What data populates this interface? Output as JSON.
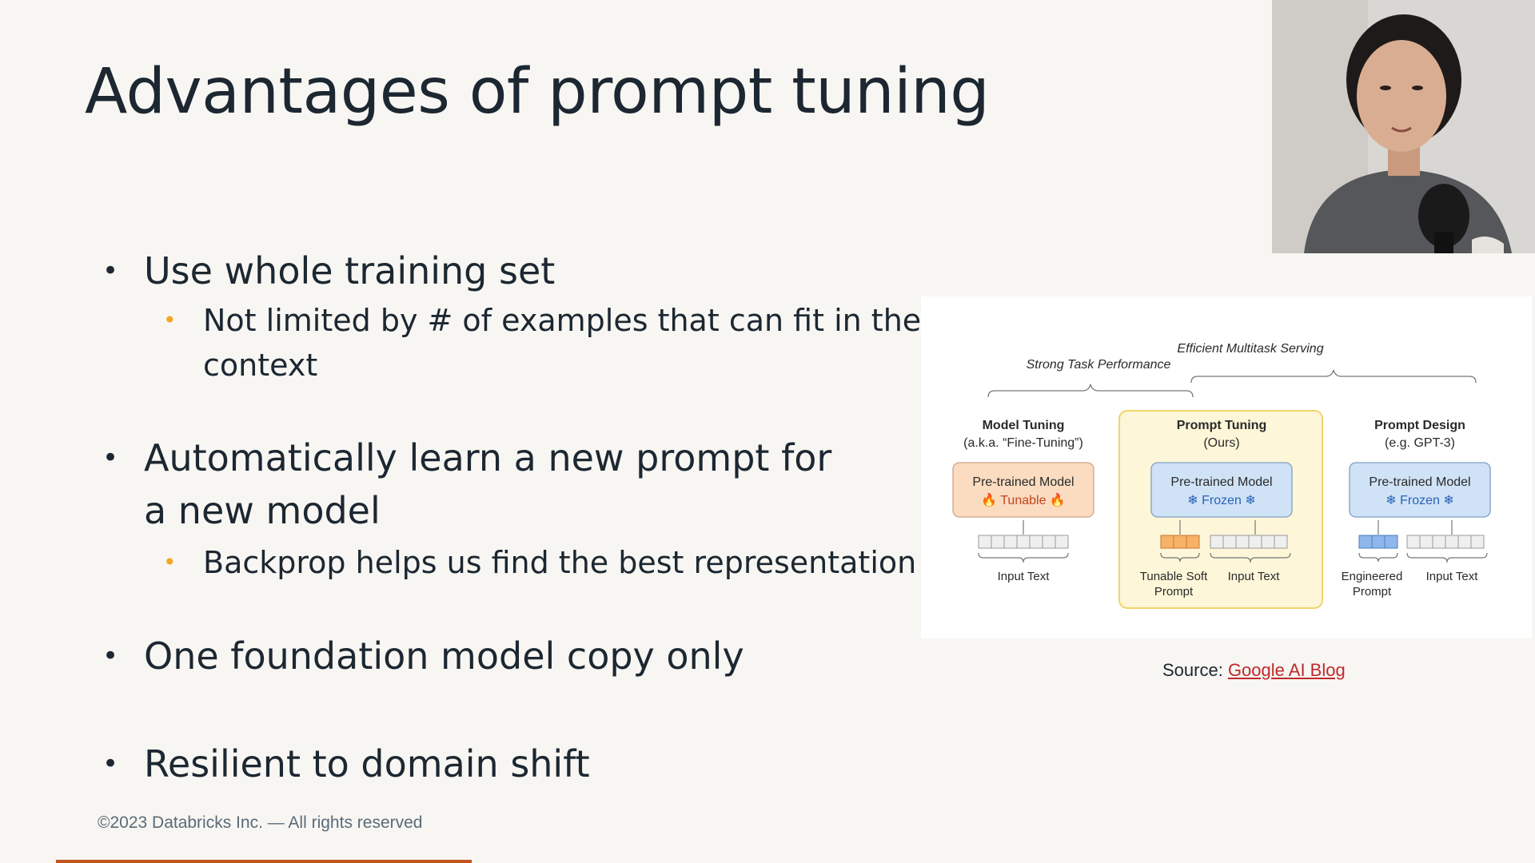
{
  "slide": {
    "title": "Advantages of prompt tuning",
    "bullets": [
      {
        "text": "Use whole training set",
        "sub": [
          "Not limited by # of examples that can fit in the context"
        ]
      },
      {
        "text": "Automatically learn a new prompt for a new model",
        "sub": [
          "Backprop helps us find the best representation"
        ]
      },
      {
        "text": "One foundation model copy only",
        "sub": []
      },
      {
        "text": "Resilient to domain shift",
        "sub": []
      }
    ],
    "footer": "©2023 Databricks Inc. — All rights reserved",
    "bullet_symbol": "•"
  },
  "figure": {
    "label_strong": "Strong Task Performance",
    "label_efficient": "Efficient Multitask Serving",
    "columns": {
      "model_tuning": {
        "title": "Model Tuning",
        "subtitle": "(a.k.a. “Fine-Tuning”)",
        "box_line1": "Pre-trained Model",
        "box_line2": "🔥 Tunable 🔥",
        "input_label": "Input Text"
      },
      "prompt_tuning": {
        "title": "Prompt Tuning",
        "subtitle": "(Ours)",
        "box_line1": "Pre-trained Model",
        "box_line2": "❄ Frozen ❄",
        "soft_label_1": "Tunable Soft",
        "soft_label_2": "Prompt",
        "input_label": "Input Text"
      },
      "prompt_design": {
        "title": "Prompt Design",
        "subtitle": "(e.g. GPT-3)",
        "box_line1": "Pre-trained Model",
        "box_line2": "❄ Frozen ❄",
        "eng_label_1": "Engineered",
        "eng_label_2": "Prompt",
        "input_label": "Input Text"
      }
    },
    "colors": {
      "tunable_fill": "#fbdcc0",
      "tunable_text": "#c4441f",
      "frozen_fill": "#cfe2f6",
      "frozen_text": "#2a62b8",
      "highlight_fill": "#fdf6d8",
      "highlight_stroke": "#f1d36a"
    }
  },
  "source": {
    "prefix": "Source: ",
    "link_text": "Google AI Blog"
  }
}
